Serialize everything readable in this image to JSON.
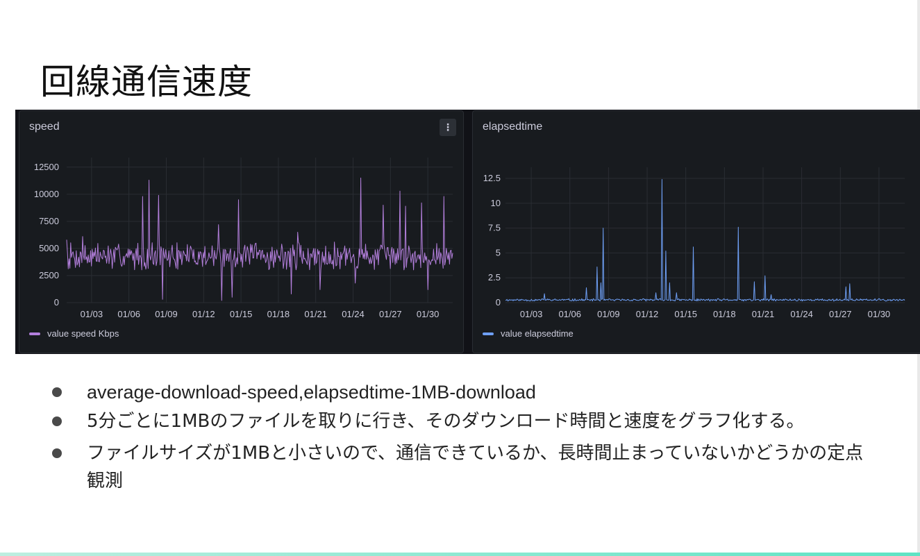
{
  "slide": {
    "title": "回線通信速度"
  },
  "bullets": [
    "average-download-speed,elapsedtime-1MB-download",
    "5分ごとに1MBのファイルを取りに行き、そのダウンロード時間と速度をグラフ化する。",
    "ファイルサイズが1MBと小さいので、通信できているか、長時間止まっていないかどうかの定点観測"
  ],
  "panels": {
    "speed": {
      "title": "speed",
      "menu_icon": "more-vertical-icon",
      "legend": "value speed Kbps"
    },
    "elapsed": {
      "title": "elapsedtime",
      "legend": "value elapsedtime"
    }
  },
  "colors": {
    "speed_series": "#b37fdc",
    "elapsed_series": "#6e9ff5",
    "panel_bg": "#181b1f",
    "grid": "#2a2d33",
    "axis_text": "#ccccdc"
  },
  "chart_data": [
    {
      "type": "line",
      "title": "speed",
      "xlabel": "",
      "ylabel": "",
      "x_range": [
        "01/01",
        "02/01"
      ],
      "x_ticks": [
        "01/03",
        "01/06",
        "01/09",
        "01/12",
        "01/15",
        "01/18",
        "01/21",
        "01/24",
        "01/27",
        "01/30"
      ],
      "y_ticks": [
        0,
        2500,
        5000,
        7500,
        10000,
        12500
      ],
      "y_tick_labels": [
        "0",
        "2500",
        "5000",
        "7500",
        "10000",
        "12500"
      ],
      "ylim": [
        0,
        13000
      ],
      "grid": true,
      "legend_position": "bottom-left",
      "series": [
        {
          "name": "value speed Kbps",
          "baseline": 4200,
          "noise_low": 3000,
          "noise_high": 5600,
          "spikes": [
            {
              "date": "01/01",
              "value": 5800
            },
            {
              "date": "01/02",
              "value": 6100
            },
            {
              "date": "01/07",
              "value": 11300
            },
            {
              "date": "01/07",
              "value": 9800
            },
            {
              "date": "01/08",
              "value": 9900
            },
            {
              "date": "01/08",
              "value": 300
            },
            {
              "date": "01/13",
              "value": 7200
            },
            {
              "date": "01/13",
              "value": 200
            },
            {
              "date": "01/14",
              "value": 9500
            },
            {
              "date": "01/14",
              "value": 500
            },
            {
              "date": "01/19",
              "value": 6500
            },
            {
              "date": "01/19",
              "value": 800
            },
            {
              "date": "01/21",
              "value": 1200
            },
            {
              "date": "01/24",
              "value": 11500
            },
            {
              "date": "01/24",
              "value": 1800
            },
            {
              "date": "01/26",
              "value": 9000
            },
            {
              "date": "01/27",
              "value": 10300
            },
            {
              "date": "01/28",
              "value": 8900
            },
            {
              "date": "01/29",
              "value": 9200
            },
            {
              "date": "01/30",
              "value": 1200
            },
            {
              "date": "01/31",
              "value": 9800
            }
          ]
        }
      ]
    },
    {
      "type": "line",
      "title": "elapsedtime",
      "xlabel": "",
      "ylabel": "",
      "x_range": [
        "01/01",
        "02/01"
      ],
      "x_ticks": [
        "01/03",
        "01/06",
        "01/09",
        "01/12",
        "01/15",
        "01/18",
        "01/21",
        "01/24",
        "01/27",
        "01/30"
      ],
      "y_ticks": [
        0,
        2.5,
        5,
        7.5,
        10,
        12.5
      ],
      "y_tick_labels": [
        "0",
        "2.5",
        "5",
        "7.5",
        "10",
        "12.5"
      ],
      "ylim": [
        0,
        13.2
      ],
      "grid": true,
      "legend_position": "bottom-left",
      "series": [
        {
          "name": "value elapsedtime",
          "baseline": 0.25,
          "noise_low": 0.15,
          "noise_high": 0.4,
          "spikes": [
            {
              "date": "01/04",
              "value": 0.9
            },
            {
              "date": "01/07",
              "value": 1.5
            },
            {
              "date": "01/08",
              "value": 7.5
            },
            {
              "date": "01/08",
              "value": 3.6
            },
            {
              "date": "01/08",
              "value": 2.0
            },
            {
              "date": "01/12",
              "value": 1.0
            },
            {
              "date": "01/13",
              "value": 12.4
            },
            {
              "date": "01/13",
              "value": 5.2
            },
            {
              "date": "01/13",
              "value": 2.0
            },
            {
              "date": "01/14",
              "value": 1.0
            },
            {
              "date": "01/15",
              "value": 5.6
            },
            {
              "date": "01/19",
              "value": 7.6
            },
            {
              "date": "01/20",
              "value": 2.1
            },
            {
              "date": "01/21",
              "value": 0.8
            },
            {
              "date": "01/21",
              "value": 2.7
            },
            {
              "date": "01/27",
              "value": 1.6
            },
            {
              "date": "01/27",
              "value": 1.9
            }
          ]
        }
      ]
    }
  ]
}
